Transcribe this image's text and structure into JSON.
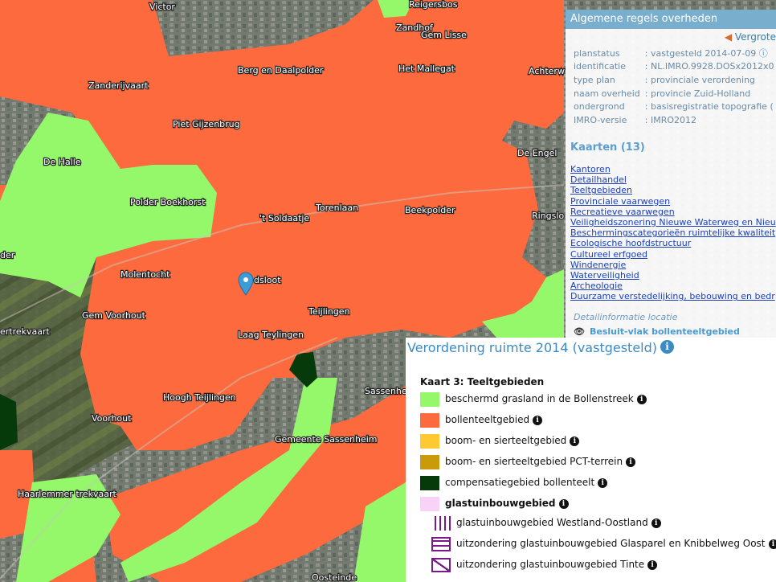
{
  "map": {
    "places": [
      "Victor",
      "Reigersbos",
      "Zandhof",
      "Gem Lisse",
      "Berg en Daalpolder",
      "Het Mallegat",
      "Achterw",
      "Zanderijvaart",
      "Piet Gijzenbrug",
      "De Halle",
      "De Engel",
      "Polder Boekhorst",
      "'t Soldaatje",
      "Torenlaan",
      "Beekpolder",
      "Ringslo",
      "der",
      "Molentocht",
      "dsloot",
      "Gem Voorhout",
      "Teijlingen",
      "ertrekvaart",
      "Laag Teylingen",
      "Sassenhe",
      "Hoogh Teijlingen",
      "Voorhout",
      "Gemeente Sassenheim",
      "Haarlemmer trekvaart",
      "Oosteinde"
    ],
    "marker_icon": "map-pin-icon"
  },
  "info": {
    "header": "Algemene regels overheden",
    "back_link": "Vergrote",
    "meta": [
      {
        "key": "planstatus",
        "value": ": vastgesteld 2014-07-09"
      },
      {
        "key": "identificatie",
        "value": ": NL.IMRO.9928.DOSx2012x0"
      },
      {
        "key": "type plan",
        "value": ": provinciale verordening"
      },
      {
        "key": "naam overheid",
        "value": ": provincie Zuid-Holland"
      },
      {
        "key": "ondergrond",
        "value": ": basisregistratie topografie ("
      },
      {
        "key": "IMRO-versie",
        "value": ": IMRO2012"
      }
    ],
    "kaarten_title": "Kaarten (13)",
    "kaarten": [
      "Kantoren",
      "Detailhandel",
      "Teeltgebieden",
      "Provinciale vaarwegen",
      "Recreatieve vaarwegen",
      "Veiligheidszonering Nieuwe Waterweg en Nieu",
      "Beschermingscategorieën ruimtelijke kwaliteit",
      "Ecologische hoofdstructuur",
      "Cultureel erfgoed",
      "Windenergie",
      "Waterveiligheid",
      "Archeologie",
      "Duurzame verstedelijking, bebouwing en bedr"
    ],
    "detail_label": "Detailinformatie locatie",
    "besluit_label": "Besluit-vlak bollenteeltgebied"
  },
  "legend": {
    "title": "Verordening ruimte 2014 (vastgesteld)",
    "subtitle": "Kaart 3: Teeltgebieden",
    "items": [
      {
        "label": "beschermd grasland in de Bollenstreek",
        "color": "#95f76a",
        "pattern": "solid"
      },
      {
        "label": "bollenteeltgebied",
        "color": "#fd6a3d",
        "pattern": "solid"
      },
      {
        "label": "boom- en sierteeltgebied",
        "color": "#ffc934",
        "pattern": "solid"
      },
      {
        "label": "boom- en sierteeltgebied PCT-terrein",
        "color": "#c99a0b",
        "pattern": "solid"
      },
      {
        "label": "compensatiegebied bollenteelt",
        "color": "#073a0b",
        "pattern": "solid"
      },
      {
        "label": "glastuinbouwgebied",
        "color": "#f9d2f7",
        "pattern": "solid"
      },
      {
        "label": "glastuinbouwgebied Westland-Oostland",
        "color": "#7a1a8a",
        "pattern": "vertical"
      },
      {
        "label": "uitzondering glastuinbouwgebied Glasparel en Knibbelweg Oost",
        "color": "#7a1a8a",
        "pattern": "horizontal"
      },
      {
        "label": "uitzondering glastuinbouwgebied Tinte",
        "color": "#7a1a8a",
        "pattern": "diagonal"
      }
    ]
  }
}
